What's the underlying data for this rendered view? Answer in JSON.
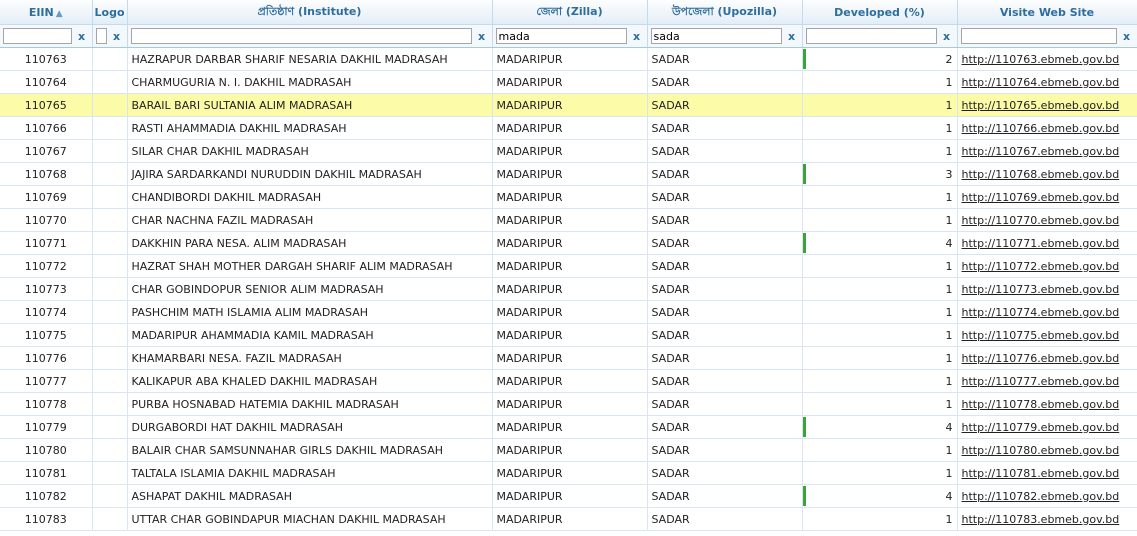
{
  "columns": {
    "eiin": "EIIN",
    "logo": "Logo",
    "institute": "প্রতিষ্ঠাণ (Institute)",
    "zilla": "জেলা (Zilla)",
    "upozilla": "উপজেলা (Upozilla)",
    "developed": "Developed (%)",
    "website": "Visite Web Site"
  },
  "filters": {
    "eiin": "",
    "logo": "",
    "institute": "",
    "zilla": "mada",
    "upozilla": "sada",
    "developed": "",
    "website": "",
    "clear_label": "x"
  },
  "selected_row": 2,
  "rows": [
    {
      "eiin": "110763",
      "institute": "HAZRAPUR DARBAR SHARIF NESARIA DAKHIL MADRASAH",
      "zilla": "MADARIPUR",
      "upozilla": "SADAR",
      "developed": 2,
      "url": "http://110763.ebmeb.gov.bd"
    },
    {
      "eiin": "110764",
      "institute": "CHARMUGURIA N. I. DAKHIL MADRASAH",
      "zilla": "MADARIPUR",
      "upozilla": "SADAR",
      "developed": 1,
      "url": "http://110764.ebmeb.gov.bd"
    },
    {
      "eiin": "110765",
      "institute": "BARAIL BARI SULTANIA ALIM MADRASAH",
      "zilla": "MADARIPUR",
      "upozilla": "SADAR",
      "developed": 1,
      "url": "http://110765.ebmeb.gov.bd"
    },
    {
      "eiin": "110766",
      "institute": "RASTI AHAMMADIA DAKHIL MADRASAH",
      "zilla": "MADARIPUR",
      "upozilla": "SADAR",
      "developed": 1,
      "url": "http://110766.ebmeb.gov.bd"
    },
    {
      "eiin": "110767",
      "institute": "SILAR CHAR DAKHIL MADRASAH",
      "zilla": "MADARIPUR",
      "upozilla": "SADAR",
      "developed": 1,
      "url": "http://110767.ebmeb.gov.bd"
    },
    {
      "eiin": "110768",
      "institute": "JAJIRA SARDARKANDI NURUDDIN DAKHIL MADRASAH",
      "zilla": "MADARIPUR",
      "upozilla": "SADAR",
      "developed": 3,
      "url": "http://110768.ebmeb.gov.bd"
    },
    {
      "eiin": "110769",
      "institute": "CHANDIBORDI DAKHIL MADRASAH",
      "zilla": "MADARIPUR",
      "upozilla": "SADAR",
      "developed": 1,
      "url": "http://110769.ebmeb.gov.bd"
    },
    {
      "eiin": "110770",
      "institute": "CHAR NACHNA FAZIL MADRASAH",
      "zilla": "MADARIPUR",
      "upozilla": "SADAR",
      "developed": 1,
      "url": "http://110770.ebmeb.gov.bd"
    },
    {
      "eiin": "110771",
      "institute": "DAKKHIN PARA NESA. ALIM MADRASAH",
      "zilla": "MADARIPUR",
      "upozilla": "SADAR",
      "developed": 4,
      "url": "http://110771.ebmeb.gov.bd"
    },
    {
      "eiin": "110772",
      "institute": "HAZRAT SHAH MOTHER DARGAH SHARIF ALIM MADRASAH",
      "zilla": "MADARIPUR",
      "upozilla": "SADAR",
      "developed": 1,
      "url": "http://110772.ebmeb.gov.bd"
    },
    {
      "eiin": "110773",
      "institute": "CHAR GOBINDOPUR SENIOR ALIM MADRASAH",
      "zilla": "MADARIPUR",
      "upozilla": "SADAR",
      "developed": 1,
      "url": "http://110773.ebmeb.gov.bd"
    },
    {
      "eiin": "110774",
      "institute": "PASHCHIM MATH ISLAMIA ALIM MADRASAH",
      "zilla": "MADARIPUR",
      "upozilla": "SADAR",
      "developed": 1,
      "url": "http://110774.ebmeb.gov.bd"
    },
    {
      "eiin": "110775",
      "institute": "MADARIPUR AHAMMADIA KAMIL MADRASAH",
      "zilla": "MADARIPUR",
      "upozilla": "SADAR",
      "developed": 1,
      "url": "http://110775.ebmeb.gov.bd"
    },
    {
      "eiin": "110776",
      "institute": "KHAMARBARI NESA. FAZIL MADRASAH",
      "zilla": "MADARIPUR",
      "upozilla": "SADAR",
      "developed": 1,
      "url": "http://110776.ebmeb.gov.bd"
    },
    {
      "eiin": "110777",
      "institute": "KALIKAPUR ABA KHALED DAKHIL MADRASAH",
      "zilla": "MADARIPUR",
      "upozilla": "SADAR",
      "developed": 1,
      "url": "http://110777.ebmeb.gov.bd"
    },
    {
      "eiin": "110778",
      "institute": "PURBA HOSNABAD HATEMIA DAKHIL MADRASAH",
      "zilla": "MADARIPUR",
      "upozilla": "SADAR",
      "developed": 1,
      "url": "http://110778.ebmeb.gov.bd"
    },
    {
      "eiin": "110779",
      "institute": "DURGABORDI HAT DAKHIL MADRASAH",
      "zilla": "MADARIPUR",
      "upozilla": "SADAR",
      "developed": 4,
      "url": "http://110779.ebmeb.gov.bd"
    },
    {
      "eiin": "110780",
      "institute": "BALAIR CHAR SAMSUNNAHAR GIRLS DAKHIL MADRASAH",
      "zilla": "MADARIPUR",
      "upozilla": "SADAR",
      "developed": 1,
      "url": "http://110780.ebmeb.gov.bd"
    },
    {
      "eiin": "110781",
      "institute": "TALTALA ISLAMIA DAKHIL MADRASAH",
      "zilla": "MADARIPUR",
      "upozilla": "SADAR",
      "developed": 1,
      "url": "http://110781.ebmeb.gov.bd"
    },
    {
      "eiin": "110782",
      "institute": "ASHAPAT DAKHIL MADRASAH",
      "zilla": "MADARIPUR",
      "upozilla": "SADAR",
      "developed": 4,
      "url": "http://110782.ebmeb.gov.bd"
    },
    {
      "eiin": "110783",
      "institute": "UTTAR CHAR GOBINDAPUR MIACHAN DAKHIL MADRASAH",
      "zilla": "MADARIPUR",
      "upozilla": "SADAR",
      "developed": 1,
      "url": "http://110783.ebmeb.gov.bd"
    }
  ]
}
